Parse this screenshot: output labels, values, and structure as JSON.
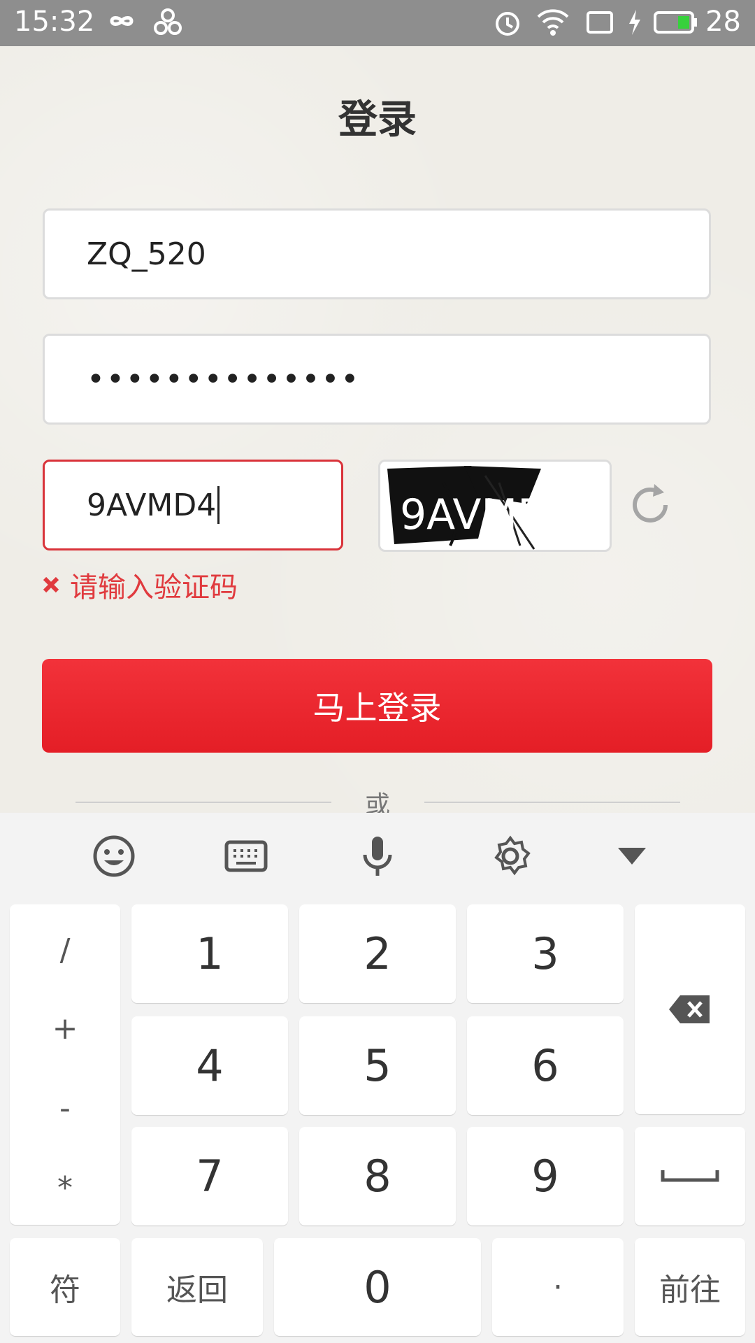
{
  "status_bar": {
    "time": "15:32",
    "battery": "28"
  },
  "page": {
    "title": "登录"
  },
  "form": {
    "username_value": "ZQ_520",
    "password_value": "••••••••••••••",
    "captcha_value": "9AVMD4",
    "captcha_image_text": "9AVMD4",
    "error_text": "请输入验证码",
    "login_button": "马上登录",
    "or_text": "或"
  },
  "colors": {
    "accent": "#e41e26",
    "error": "#e03a3e"
  },
  "keyboard": {
    "toolbar_icons": [
      "emoji-icon",
      "keyboard-icon",
      "microphone-icon",
      "settings-icon",
      "collapse-icon"
    ],
    "symbols": [
      "/",
      "+",
      "-",
      "*"
    ],
    "digits": [
      "1",
      "2",
      "3",
      "4",
      "5",
      "6",
      "7",
      "8",
      "9",
      "0"
    ],
    "fu_label": "符",
    "back_label": "返回",
    "dot_label": "·",
    "go_label": "前往"
  }
}
